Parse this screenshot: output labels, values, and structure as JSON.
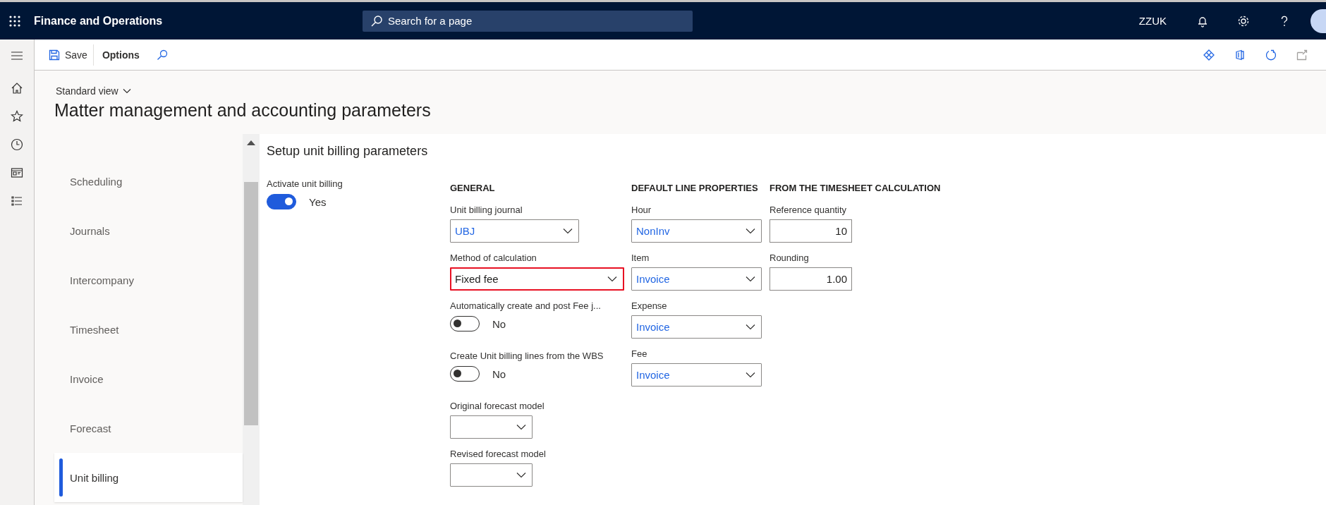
{
  "app": {
    "title": "Finance and Operations",
    "company": "ZZUK"
  },
  "search": {
    "placeholder": "Search for a page"
  },
  "commands": [
    {
      "kind": "save",
      "label": "Save"
    },
    {
      "kind": "text",
      "label": "Options"
    }
  ],
  "view": {
    "label": "Standard view"
  },
  "page_title": "Matter management and accounting parameters",
  "sections": [
    {
      "label": "Scheduling",
      "selected": false
    },
    {
      "label": "Journals",
      "selected": false
    },
    {
      "label": "Intercompany",
      "selected": false
    },
    {
      "label": "Timesheet",
      "selected": false
    },
    {
      "label": "Invoice",
      "selected": false
    },
    {
      "label": "Forecast",
      "selected": false
    },
    {
      "label": "Unit billing",
      "selected": true
    }
  ],
  "form": {
    "title": "Setup unit billing parameters",
    "activate": {
      "label": "Activate unit billing",
      "on": true,
      "state_label": "Yes"
    },
    "groups": [
      {
        "heading": "GENERAL",
        "fields": [
          {
            "kind": "lookup",
            "label": "Unit billing journal",
            "value": "UBJ",
            "highlighted": false
          },
          {
            "kind": "enum",
            "label": "Method of calculation",
            "value": "Fixed fee",
            "highlighted": true
          },
          {
            "kind": "toggle",
            "label": "Automatically create and post Fee j...",
            "on": false,
            "state_label": "No"
          },
          {
            "kind": "toggle",
            "label": "Create Unit billing lines from the WBS",
            "on": false,
            "state_label": "No"
          },
          {
            "kind": "lookup",
            "label": "Original forecast model",
            "highlighted": false
          },
          {
            "kind": "lookup",
            "label": "Revised forecast model",
            "highlighted": false
          }
        ]
      },
      {
        "heading": "DEFAULT LINE PROPERTIES",
        "fields": [
          {
            "kind": "lookup",
            "label": "Hour",
            "value": "NonInv",
            "highlighted": false
          },
          {
            "kind": "lookup",
            "label": "Item",
            "value": "Invoice",
            "highlighted": false
          },
          {
            "kind": "lookup",
            "label": "Expense",
            "value": "Invoice",
            "highlighted": false
          },
          {
            "kind": "lookup",
            "label": "Fee",
            "value": "Invoice",
            "highlighted": false
          }
        ]
      },
      {
        "heading": "FROM THE TIMESHEET CALCULATION",
        "fields": [
          {
            "kind": "number",
            "label": "Reference quantity",
            "value": "10"
          },
          {
            "kind": "number",
            "label": "Rounding",
            "value": "1.00"
          }
        ]
      }
    ]
  }
}
